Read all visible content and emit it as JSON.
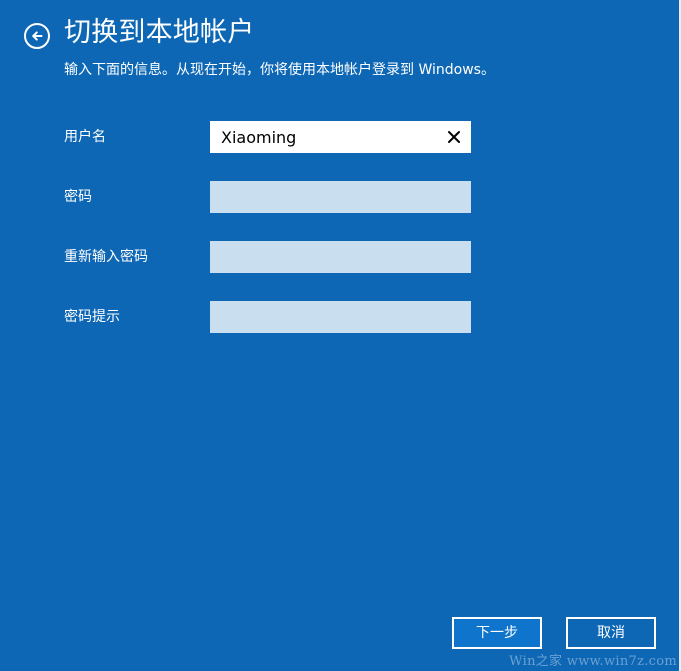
{
  "header": {
    "title": "切换到本地帐户",
    "subtitle": "输入下面的信息。从现在开始，你将使用本地帐户登录到 Windows。"
  },
  "form": {
    "username_label": "用户名",
    "username_value": "Xiaoming",
    "password_label": "密码",
    "password_value": "",
    "confirm_password_label": "重新输入密码",
    "confirm_password_value": "",
    "hint_label": "密码提示",
    "hint_value": ""
  },
  "actions": {
    "next_label": "下一步",
    "cancel_label": "取消"
  },
  "watermark": {
    "text": "Win之家 www.win7z.com"
  },
  "theme": {
    "background": "#0d67b5",
    "active_input_bg": "#ffffff",
    "inactive_input_bg": "#c9dff0",
    "text_color": "#ffffff"
  },
  "icons": {
    "back": "back-arrow-circle-icon",
    "clear": "clear-icon"
  }
}
